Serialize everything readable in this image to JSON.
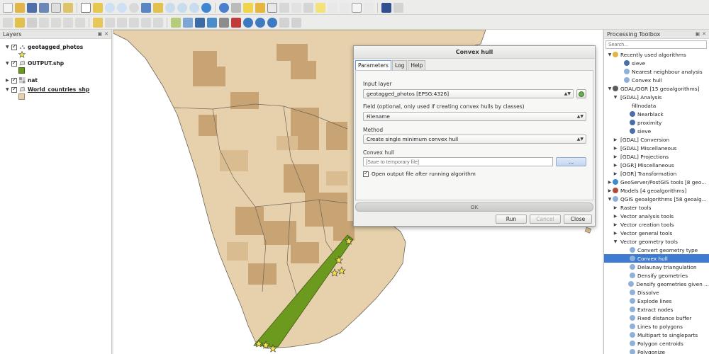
{
  "layers_panel": {
    "title": "Layers",
    "items": [
      {
        "label": "geotagged_photos",
        "checked": true
      },
      {
        "label": "OUTPUT.shp",
        "checked": true
      },
      {
        "label": "nat",
        "checked": true
      },
      {
        "label": "World_countries_shp",
        "checked": true
      }
    ]
  },
  "colors": {
    "country_fill": "#e6d1ac",
    "raster_dark": "#c8a474",
    "hull_fill": "#6b9a1e",
    "photo_star": "#f2e24a",
    "selection": "#3f7bd0"
  },
  "dialog": {
    "title": "Convex hull",
    "tabs": [
      "Parameters",
      "Log",
      "Help"
    ],
    "input_layer_label": "Input layer",
    "input_layer_value": "geotagged_photos [EPSG:4326]",
    "field_label": "Field (optional, only used if creating convex hulls by classes)",
    "field_value": "Filename",
    "method_label": "Method",
    "method_value": "Create single minimum convex hull",
    "output_label": "Convex hull",
    "output_placeholder": "[Save to temporary file]",
    "browse_label": "...",
    "open_output_label": "Open output file after running algorithm",
    "open_output_checked": true,
    "progress_text": "OK",
    "run_label": "Run",
    "cancel_label": "Cancel",
    "close_label": "Close"
  },
  "toolbox": {
    "title": "Processing Toolbox",
    "search_placeholder": "Search...",
    "rows": [
      {
        "label": "Recently used algorithms",
        "arrow": "▼",
        "indent": 0,
        "icon": "folder-icon"
      },
      {
        "label": "sieve",
        "indent": 2,
        "icon": "gdal-icon"
      },
      {
        "label": "Nearest neighbour analysis",
        "indent": 2,
        "icon": "qgis-icon"
      },
      {
        "label": "Convex hull",
        "indent": 2,
        "icon": "qgis-icon"
      },
      {
        "label": "GDAL/OGR [15 geoalgorithms]",
        "arrow": "▼",
        "indent": 0,
        "icon": "gdal-provider-icon"
      },
      {
        "label": "[GDAL] Analysis",
        "arrow": "▼",
        "indent": 1
      },
      {
        "label": "fillnodata",
        "indent": 3
      },
      {
        "label": "Nearblack",
        "indent": 3,
        "icon": "gdal-icon"
      },
      {
        "label": "proximity",
        "indent": 3,
        "icon": "gdal-icon"
      },
      {
        "label": "sieve",
        "indent": 3,
        "icon": "gdal-icon"
      },
      {
        "label": "[GDAL] Conversion",
        "arrow": "▶",
        "indent": 1
      },
      {
        "label": "[GDAL] Miscellaneous",
        "arrow": "▶",
        "indent": 1
      },
      {
        "label": "[GDAL] Projections",
        "arrow": "▶",
        "indent": 1
      },
      {
        "label": "[OGR] Miscellaneous",
        "arrow": "▶",
        "indent": 1
      },
      {
        "label": "[OGR] Transformation",
        "arrow": "▶",
        "indent": 1
      },
      {
        "label": "GeoServer/PostGIS tools [8 geo...",
        "arrow": "▶",
        "indent": 0,
        "icon": "geoserver-icon"
      },
      {
        "label": "Models [4 geoalgorithms]",
        "arrow": "▶",
        "indent": 0,
        "icon": "models-icon"
      },
      {
        "label": "QGIS geoalgorithms [58 geoalg...",
        "arrow": "▼",
        "indent": 0,
        "icon": "qgis-icon"
      },
      {
        "label": "Raster tools",
        "arrow": "▶",
        "indent": 1
      },
      {
        "label": "Vector analysis tools",
        "arrow": "▶",
        "indent": 1
      },
      {
        "label": "Vector creation tools",
        "arrow": "▶",
        "indent": 1
      },
      {
        "label": "Vector general tools",
        "arrow": "▶",
        "indent": 1
      },
      {
        "label": "Vector geometry tools",
        "arrow": "▼",
        "indent": 1
      },
      {
        "label": "Convert geometry type",
        "indent": 3,
        "icon": "qgis-icon"
      },
      {
        "label": "Convex hull",
        "indent": 3,
        "icon": "qgis-icon",
        "selected": true
      },
      {
        "label": "Delaunay triangulation",
        "indent": 3,
        "icon": "qgis-icon"
      },
      {
        "label": "Densify geometries",
        "indent": 3,
        "icon": "qgis-icon"
      },
      {
        "label": "Densify geometries given ...",
        "indent": 3,
        "icon": "qgis-icon"
      },
      {
        "label": "Dissolve",
        "indent": 3,
        "icon": "qgis-icon"
      },
      {
        "label": "Explode lines",
        "indent": 3,
        "icon": "qgis-icon"
      },
      {
        "label": "Extract nodes",
        "indent": 3,
        "icon": "qgis-icon"
      },
      {
        "label": "Fixed distance buffer",
        "indent": 3,
        "icon": "qgis-icon"
      },
      {
        "label": "Lines to polygons",
        "indent": 3,
        "icon": "qgis-icon"
      },
      {
        "label": "Multipart to singleparts",
        "indent": 3,
        "icon": "qgis-icon"
      },
      {
        "label": "Polygon centroids",
        "indent": 3,
        "icon": "qgis-icon"
      },
      {
        "label": "Polygonize",
        "indent": 3,
        "icon": "qgis-icon"
      }
    ]
  }
}
